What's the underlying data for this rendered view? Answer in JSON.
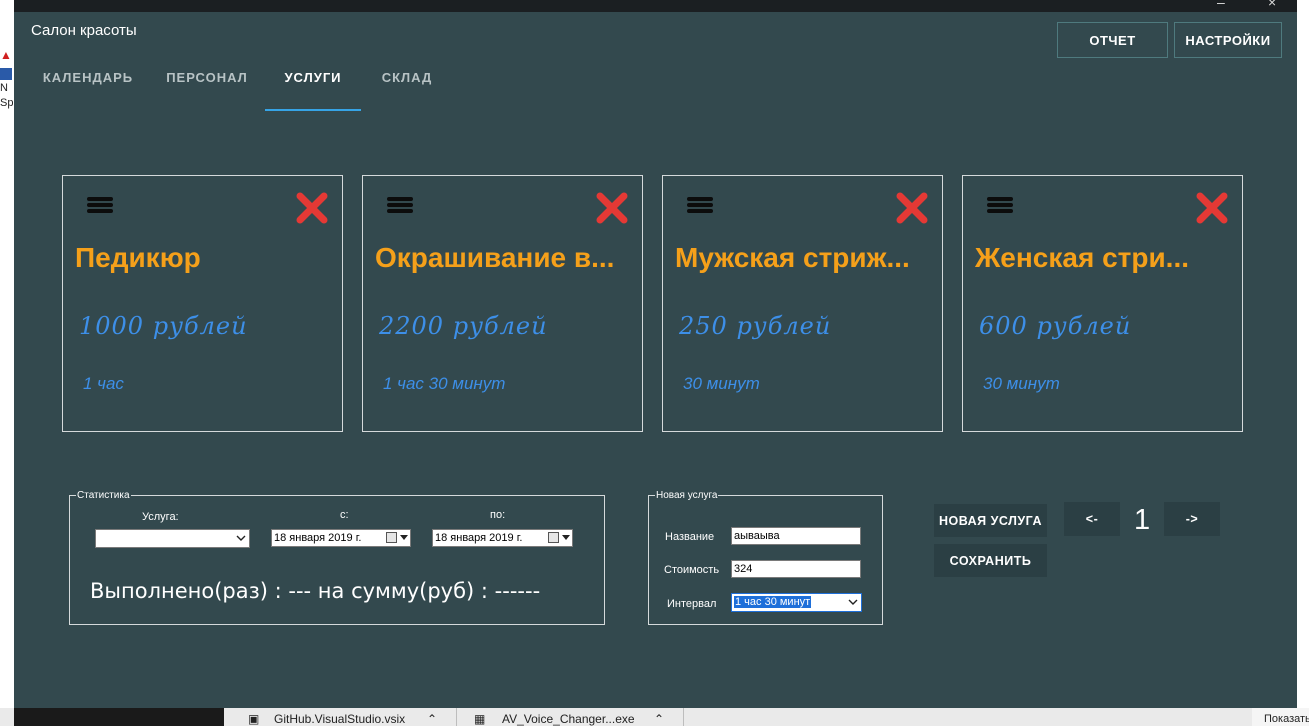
{
  "app": {
    "title": "Салон красоты"
  },
  "header_buttons": {
    "report": "ОТЧЕТ",
    "settings": "НАСТРОЙКИ"
  },
  "tabs": [
    {
      "label": "КАЛЕНДАРЬ",
      "active": false
    },
    {
      "label": "ПЕРСОНАЛ",
      "active": false
    },
    {
      "label": "УСЛУГИ",
      "active": true
    },
    {
      "label": "СКЛАД",
      "active": false
    }
  ],
  "services": [
    {
      "name": "Педикюр",
      "price": "1000 рублей",
      "duration": "1 час"
    },
    {
      "name": "Окрашивание в...",
      "price": "2200 рублей",
      "duration": "1 час 30 минут"
    },
    {
      "name": "Мужская стриж...",
      "price": "250 рублей",
      "duration": "30 минут"
    },
    {
      "name": "Женская стри...",
      "price": "600 рублей",
      "duration": "30 минут"
    }
  ],
  "statistics": {
    "legend": "Статистика",
    "service_label": "Услуга:",
    "from_label": "с:",
    "to_label": "по:",
    "service_value": "",
    "date_from": "18  января  2019 г.",
    "date_to": "18  января  2019 г.",
    "summary": "Выполнено(раз) : --- на сумму(руб) : ------"
  },
  "new_service": {
    "legend": "Новая услуга",
    "name_label": "Название",
    "name_value": "аываыва",
    "cost_label": "Стоимость",
    "cost_value": "324",
    "interval_label": "Интервал",
    "interval_value": "1 час 30 минут"
  },
  "actions": {
    "new_service": "НОВАЯ УСЛУГА",
    "save": "СОХРАНИТЬ",
    "prev": "<-",
    "next": "->",
    "page": "1"
  },
  "desktop": {
    "left_text_1": "N",
    "left_text_2": "Sp"
  },
  "taskbar": {
    "items": [
      "GitHub.VisualStudio.vsix",
      "AV_Voice_Changer...exe"
    ],
    "right_text": "Показать"
  },
  "colors": {
    "window_bg": "#33494e",
    "accent_tab": "#36a4e6",
    "service_name": "#f5a01a",
    "service_price": "#3d8fe8",
    "delete_icon": "#e53935"
  }
}
